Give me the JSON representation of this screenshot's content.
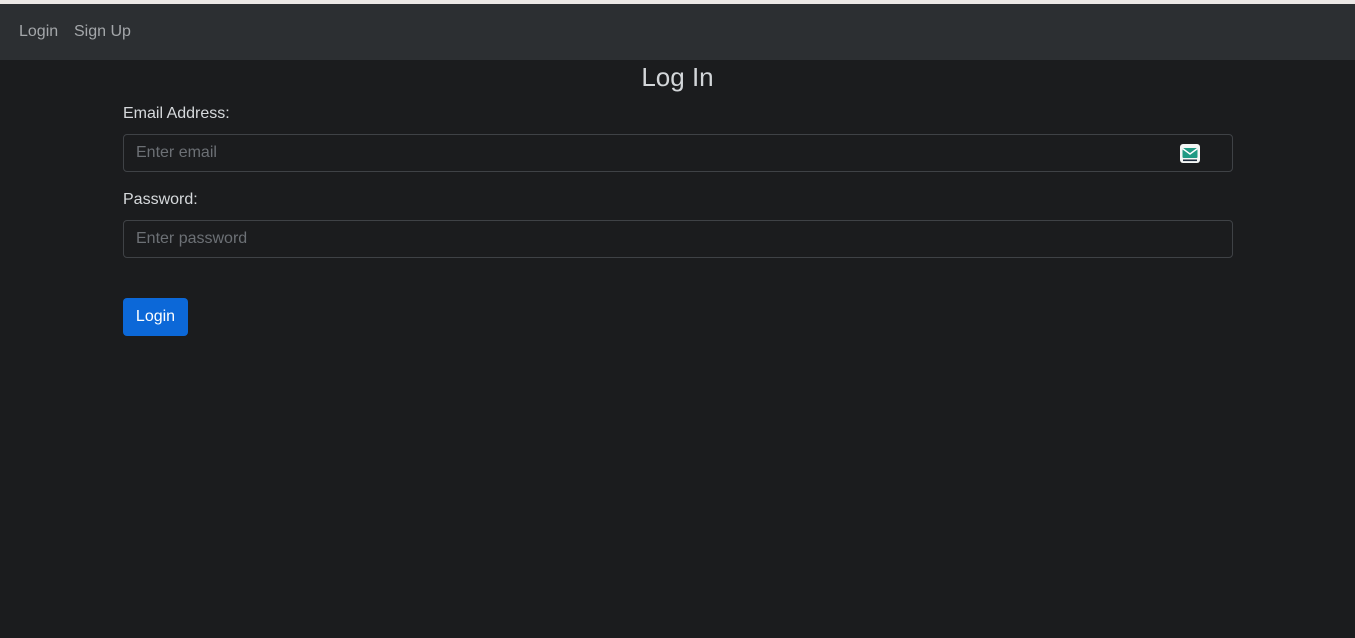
{
  "nav": {
    "login_label": "Login",
    "signup_label": "Sign Up"
  },
  "page": {
    "title": "Log In"
  },
  "form": {
    "email_label": "Email Address:",
    "email_placeholder": "Enter email",
    "email_value": "",
    "password_label": "Password:",
    "password_placeholder": "Enter password",
    "password_value": "",
    "submit_label": "Login"
  },
  "icons": {
    "email_field_icon": "mail-icon"
  },
  "colors": {
    "background": "#1b1c1e",
    "navbar": "#2c2f32",
    "primary_button": "#0c68d8",
    "mail_icon_accent": "#1f9a84"
  }
}
